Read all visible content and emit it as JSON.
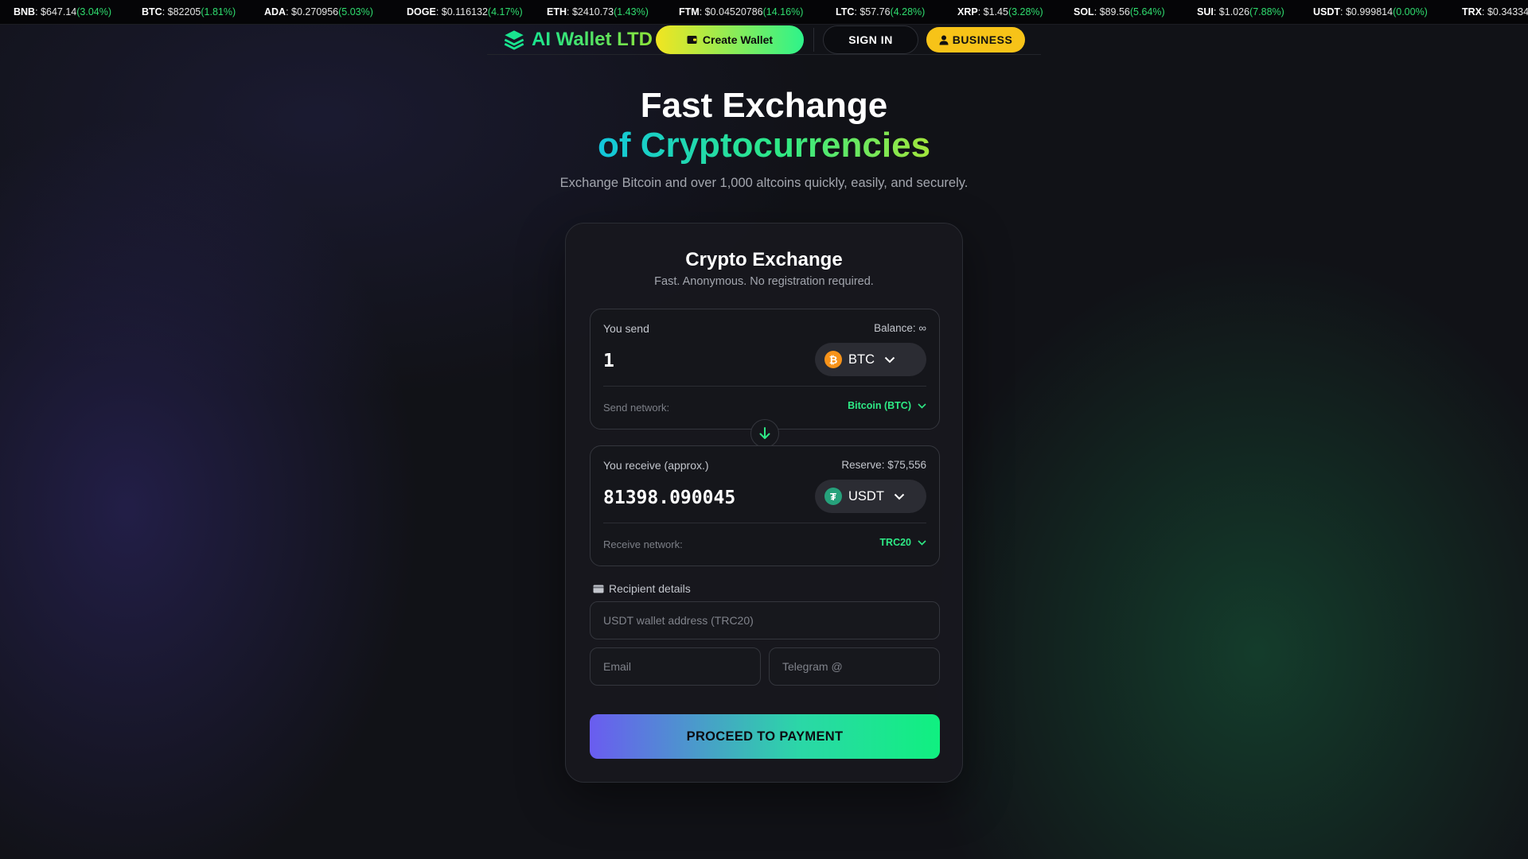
{
  "ticker": [
    {
      "symbol": "BNB",
      "price": ": $647.14",
      "change": "(3.04%)"
    },
    {
      "symbol": "BTC",
      "price": ": $82205",
      "change": "(1.81%)"
    },
    {
      "symbol": "ADA",
      "price": ": $0.270956",
      "change": "(5.03%)"
    },
    {
      "symbol": "DOGE",
      "price": ": $0.116132",
      "change": "(4.17%)"
    },
    {
      "symbol": "ETH",
      "price": ": $2410.73",
      "change": "(1.43%)"
    },
    {
      "symbol": "FTM",
      "price": ": $0.04520786",
      "change": "(14.16%)"
    },
    {
      "symbol": "LTC",
      "price": ": $57.76",
      "change": "(4.28%)"
    },
    {
      "symbol": "XRP",
      "price": ": $1.45",
      "change": "(3.28%)"
    },
    {
      "symbol": "SOL",
      "price": ": $89.56",
      "change": "(5.64%)"
    },
    {
      "symbol": "SUI",
      "price": ": $1.026",
      "change": "(7.88%)"
    },
    {
      "symbol": "USDT",
      "price": ": $0.999814",
      "change": "(0.00%)"
    },
    {
      "symbol": "TRX",
      "price": ": $0.34334",
      "change": ""
    }
  ],
  "header": {
    "logo_text": "AI Wallet LTD",
    "logo_icon": "layers-icon",
    "create_wallet": "Create Wallet",
    "create_wallet_icon": "wallet-icon",
    "sign_in": "SIGN IN",
    "business": "BUSINESS",
    "business_icon": "user-icon"
  },
  "hero": {
    "title_line1": "Fast Exchange",
    "title_line2": "of Cryptocurrencies",
    "subtitle": "Exchange Bitcoin and over 1,000 altcoins quickly, easily, and securely."
  },
  "exchange": {
    "title": "Crypto Exchange",
    "subtitle": "Fast. Anonymous. No registration required.",
    "send": {
      "label": "You send",
      "balance": "Balance: ∞",
      "amount": "1",
      "coin": "BTC",
      "coin_icon": "bitcoin-icon",
      "network_label": "Send network:",
      "network": "Bitcoin (BTC)"
    },
    "receive": {
      "label": "You receive (approx.)",
      "reserve": "Reserve: $75,556",
      "amount": "81398.090045",
      "coin": "USDT",
      "coin_icon": "tether-icon",
      "network_label": "Receive network:",
      "network": "TRC20"
    },
    "recipient": {
      "label": "Recipient details",
      "icon": "card-icon",
      "wallet_placeholder": "USDT wallet address (TRC20)",
      "email_placeholder": "Email",
      "telegram_placeholder": "Telegram @"
    },
    "proceed": "PROCEED TO PAYMENT"
  },
  "colors": {
    "accent_green": "#2ee985",
    "business_yellow": "#f7c318",
    "bitcoin_orange": "#f7931a",
    "tether_teal": "#26a17b"
  }
}
